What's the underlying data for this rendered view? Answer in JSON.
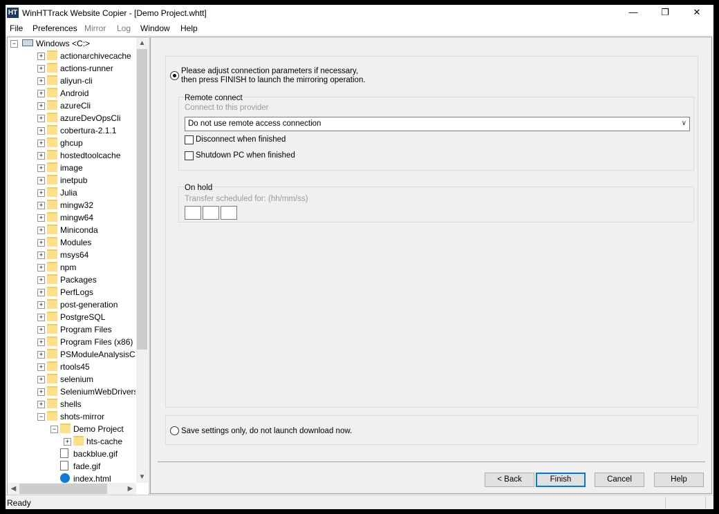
{
  "window": {
    "title": "WinHTTrack Website Copier - [Demo Project.whtt]",
    "app_icon_text": "HT",
    "controls": {
      "minimize": "—",
      "restore": "❐",
      "close": "✕"
    }
  },
  "menu": [
    "File",
    "Preferences",
    "Mirror",
    "Log",
    "Window",
    "Help"
  ],
  "tree": {
    "root": "Windows <C:>",
    "items": [
      {
        "label": "actionarchivecache",
        "type": "folder",
        "indent": 1,
        "expander": "+"
      },
      {
        "label": "actions-runner",
        "type": "folder",
        "indent": 1,
        "expander": "+"
      },
      {
        "label": "aliyun-cli",
        "type": "folder",
        "indent": 1,
        "expander": "+"
      },
      {
        "label": "Android",
        "type": "folder",
        "indent": 1,
        "expander": "+"
      },
      {
        "label": "azureCli",
        "type": "folder",
        "indent": 1,
        "expander": "+"
      },
      {
        "label": "azureDevOpsCli",
        "type": "folder",
        "indent": 1,
        "expander": "+"
      },
      {
        "label": "cobertura-2.1.1",
        "type": "folder",
        "indent": 1,
        "expander": "+"
      },
      {
        "label": "ghcup",
        "type": "folder",
        "indent": 1,
        "expander": "+"
      },
      {
        "label": "hostedtoolcache",
        "type": "folder",
        "indent": 1,
        "expander": "+"
      },
      {
        "label": "image",
        "type": "folder",
        "indent": 1,
        "expander": "+"
      },
      {
        "label": "inetpub",
        "type": "folder",
        "indent": 1,
        "expander": "+"
      },
      {
        "label": "Julia",
        "type": "folder",
        "indent": 1,
        "expander": "+"
      },
      {
        "label": "mingw32",
        "type": "folder",
        "indent": 1,
        "expander": "+"
      },
      {
        "label": "mingw64",
        "type": "folder",
        "indent": 1,
        "expander": "+"
      },
      {
        "label": "Miniconda",
        "type": "folder",
        "indent": 1,
        "expander": "+"
      },
      {
        "label": "Modules",
        "type": "folder",
        "indent": 1,
        "expander": "+"
      },
      {
        "label": "msys64",
        "type": "folder",
        "indent": 1,
        "expander": "+"
      },
      {
        "label": "npm",
        "type": "folder",
        "indent": 1,
        "expander": "+"
      },
      {
        "label": "Packages",
        "type": "folder",
        "indent": 1,
        "expander": "+"
      },
      {
        "label": "PerfLogs",
        "type": "folder",
        "indent": 1,
        "expander": "+"
      },
      {
        "label": "post-generation",
        "type": "folder",
        "indent": 1,
        "expander": "+"
      },
      {
        "label": "PostgreSQL",
        "type": "folder",
        "indent": 1,
        "expander": "+"
      },
      {
        "label": "Program Files",
        "type": "folder",
        "indent": 1,
        "expander": "+"
      },
      {
        "label": "Program Files (x86)",
        "type": "folder",
        "indent": 1,
        "expander": "+"
      },
      {
        "label": "PSModuleAnalysisCachePath",
        "type": "folder",
        "indent": 1,
        "expander": "+"
      },
      {
        "label": "rtools45",
        "type": "folder",
        "indent": 1,
        "expander": "+"
      },
      {
        "label": "selenium",
        "type": "folder",
        "indent": 1,
        "expander": "+"
      },
      {
        "label": "SeleniumWebDrivers",
        "type": "folder",
        "indent": 1,
        "expander": "+"
      },
      {
        "label": "shells",
        "type": "folder",
        "indent": 1,
        "expander": "+"
      },
      {
        "label": "shots-mirror",
        "type": "folder",
        "indent": 1,
        "expander": "−"
      },
      {
        "label": "Demo Project",
        "type": "folder",
        "indent": 2,
        "expander": "−"
      },
      {
        "label": "hts-cache",
        "type": "folder",
        "indent": 3,
        "expander": "+"
      },
      {
        "label": "backblue.gif",
        "type": "file",
        "indent": 2,
        "expander": ""
      },
      {
        "label": "fade.gif",
        "type": "file",
        "indent": 2,
        "expander": ""
      },
      {
        "label": "index.html",
        "type": "edge",
        "indent": 2,
        "expander": ""
      }
    ]
  },
  "main": {
    "finish_option": "Please adjust connection parameters if necessary,\nthen press FINISH to launch the mirroring operation.",
    "remote_connect": {
      "title": "Remote connect",
      "subtitle": "Connect to this provider",
      "selected": "Do not use remote access connection",
      "disconnect_label": "Disconnect when finished",
      "shutdown_label": "Shutdown PC when finished"
    },
    "on_hold": {
      "title": "On hold",
      "subtitle": "Transfer scheduled for: (hh/mm/ss)"
    },
    "save_option": "Save settings only, do not launch download now."
  },
  "buttons": {
    "back": "< Back",
    "finish": "Finish",
    "cancel": "Cancel",
    "help": "Help"
  },
  "status": {
    "text": "Ready"
  },
  "colors": {
    "accent": "#0078d7",
    "folder": "#ffe08a"
  }
}
